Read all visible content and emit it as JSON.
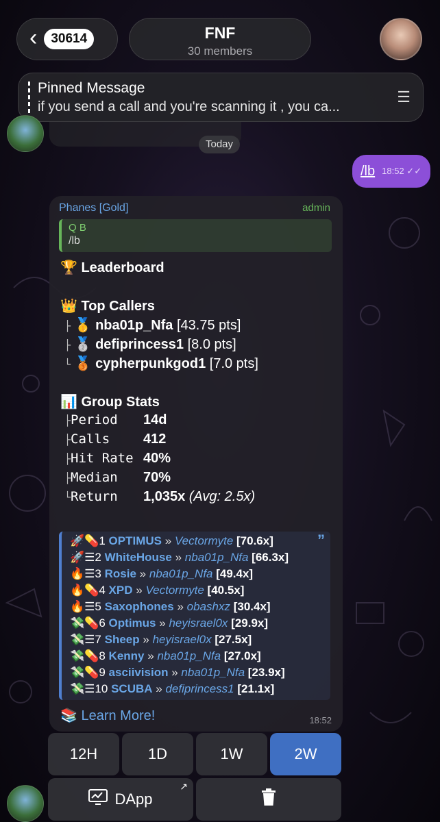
{
  "header": {
    "back_count": "30614",
    "title": "FNF",
    "subtitle": "30 members"
  },
  "pinned": {
    "label": "Pinned Message",
    "text": "if you send a call and you're scanning it , you ca..."
  },
  "date_separator": "Today",
  "outgoing": {
    "text": "/lb",
    "time": "18:52"
  },
  "bot_message": {
    "sender": "Phanes [Gold]",
    "role": "admin",
    "reply_to": {
      "name": "Q B",
      "text": "/lb"
    },
    "heading": "Leaderboard",
    "top_callers_title": "Top Callers",
    "top_callers": [
      {
        "name": "nba01p_Nfa",
        "pts": "[43.75 pts]"
      },
      {
        "name": "defiprincess1",
        "pts": "[8.0 pts]"
      },
      {
        "name": "cypherpunkgod1",
        "pts": "[7.0 pts]"
      }
    ],
    "group_stats_title": "Group Stats",
    "stats": [
      {
        "label": "Period",
        "value": "14d",
        "extra": ""
      },
      {
        "label": "Calls",
        "value": "412",
        "extra": ""
      },
      {
        "label": "Hit Rate",
        "value": "40%",
        "extra": ""
      },
      {
        "label": "Median",
        "value": "70%",
        "extra": ""
      },
      {
        "label": "Return",
        "value": "1,035x",
        "extra": "(Avg: 2.5x)"
      }
    ],
    "calls": [
      {
        "icons": "🚀💊",
        "rank": "1",
        "token": "OPTIMUS",
        "caller": "Vectormyte",
        "mult": "[70.6x]"
      },
      {
        "icons": "🚀☰",
        "rank": "2",
        "token": "WhiteHouse",
        "caller": "nba01p_Nfa",
        "mult": "[66.3x]"
      },
      {
        "icons": "🔥☰",
        "rank": "3",
        "token": "Rosie",
        "caller": "nba01p_Nfa",
        "mult": "[49.4x]"
      },
      {
        "icons": "🔥💊",
        "rank": "4",
        "token": "XPD",
        "caller": "Vectormyte",
        "mult": "[40.5x]"
      },
      {
        "icons": "🔥☰",
        "rank": "5",
        "token": "Saxophones",
        "caller": "obashxz",
        "mult": "[30.4x]"
      },
      {
        "icons": "💸💊",
        "rank": "6",
        "token": "Optimus",
        "caller": "heyisrael0x",
        "mult": "[29.9x]"
      },
      {
        "icons": "💸☰",
        "rank": "7",
        "token": "Sheep",
        "caller": "heyisrael0x",
        "mult": "[27.5x]"
      },
      {
        "icons": "💸💊",
        "rank": "8",
        "token": "Kenny",
        "caller": "nba01p_Nfa",
        "mult": "[27.0x]"
      },
      {
        "icons": "💸💊",
        "rank": "9",
        "token": "asciivision",
        "caller": "nba01p_Nfa",
        "mult": "[23.9x]"
      },
      {
        "icons": "💸☰",
        "rank": "10",
        "token": "SCUBA",
        "caller": "defiprincess1",
        "mult": "[21.1x]"
      }
    ],
    "learn_more": "Learn More!",
    "time": "18:52"
  },
  "keyboard": {
    "row1": [
      "12H",
      "1D",
      "1W",
      "2W"
    ],
    "active": "2W",
    "dapp_label": "DApp",
    "icons": {
      "dapp": "chart-monitor-icon",
      "delete": "trash-icon",
      "external": "arrow-up-right-icon"
    }
  },
  "colors": {
    "accent_purple": "#8c4fd8",
    "link_blue": "#6aa6e6",
    "admin_green": "#67b65a",
    "active_key": "#3f6fc2"
  }
}
